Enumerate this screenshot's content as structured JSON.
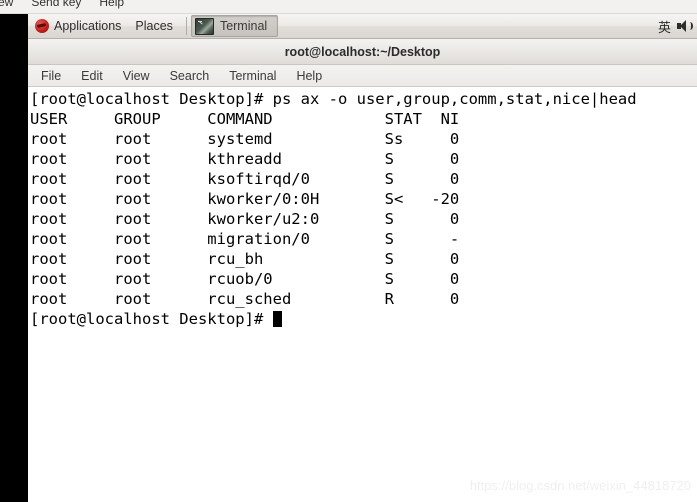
{
  "host_menubar": {
    "items": [
      {
        "label": "ew",
        "name": "host-menu-view"
      },
      {
        "label": "Send key",
        "name": "host-menu-send-key"
      },
      {
        "label": "Help",
        "name": "host-menu-help"
      }
    ]
  },
  "panel": {
    "applications_label": "Applications",
    "places_label": "Places",
    "applications_icon": "fedora-logo-icon",
    "task_button": {
      "label": "Terminal",
      "icon": "terminal-icon",
      "active": true
    },
    "right": {
      "ime_label": "英",
      "volume_icon": "volume-speaker-icon"
    }
  },
  "terminal": {
    "title": "root@localhost:~/Desktop",
    "menu": [
      {
        "label": "File",
        "name": "terminal-menu-file"
      },
      {
        "label": "Edit",
        "name": "terminal-menu-edit"
      },
      {
        "label": "View",
        "name": "terminal-menu-view"
      },
      {
        "label": "Search",
        "name": "terminal-menu-search"
      },
      {
        "label": "Terminal",
        "name": "terminal-menu-terminal"
      },
      {
        "label": "Help",
        "name": "terminal-menu-help"
      }
    ],
    "lines": [
      "[root@localhost Desktop]# ps ax -o user,group,comm,stat,nice|head",
      "USER     GROUP     COMMAND            STAT  NI",
      "root     root      systemd            Ss     0",
      "root     root      kthreadd           S      0",
      "root     root      ksoftirqd/0        S      0",
      "root     root      kworker/0:0H       S<   -20",
      "root     root      kworker/u2:0       S      0",
      "root     root      migration/0        S      -",
      "root     root      rcu_bh             S      0",
      "root     root      rcuob/0            S      0",
      "root     root      rcu_sched          R      0"
    ],
    "prompt": "[root@localhost Desktop]# ",
    "command_entered": "ps ax -o user,group,comm,stat,nice|head",
    "table": {
      "headers": [
        "USER",
        "GROUP",
        "COMMAND",
        "STAT",
        "NI"
      ],
      "rows": [
        [
          "root",
          "root",
          "systemd",
          "Ss",
          "0"
        ],
        [
          "root",
          "root",
          "kthreadd",
          "S",
          "0"
        ],
        [
          "root",
          "root",
          "ksoftirqd/0",
          "S",
          "0"
        ],
        [
          "root",
          "root",
          "kworker/0:0H",
          "S<",
          "-20"
        ],
        [
          "root",
          "root",
          "kworker/u2:0",
          "S",
          "0"
        ],
        [
          "root",
          "root",
          "migration/0",
          "S",
          "-"
        ],
        [
          "root",
          "root",
          "rcu_bh",
          "S",
          "0"
        ],
        [
          "root",
          "root",
          "rcuob/0",
          "S",
          "0"
        ],
        [
          "root",
          "root",
          "rcu_sched",
          "R",
          "0"
        ]
      ]
    }
  },
  "watermark": {
    "text": "https://blog.csdn.net/weixin_44818720"
  }
}
